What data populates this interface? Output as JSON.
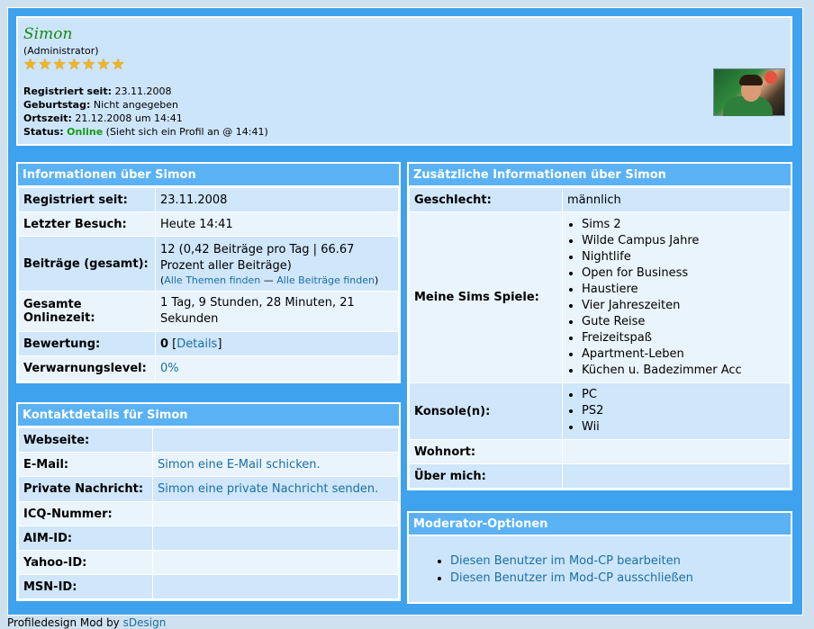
{
  "profile": {
    "username": "Simon",
    "role": "(Administrator)",
    "rank_stars": 7,
    "registered_label": "Registriert seit:",
    "registered_value": "23.11.2008",
    "birthday_label": "Geburtstag:",
    "birthday_value": "Nicht angegeben",
    "localtime_label": "Ortszeit:",
    "localtime_value": "21.12.2008 um 14:41",
    "status_label": "Status:",
    "status_value": "Online",
    "status_note": "(Sieht sich ein Profil an @ 14:41)"
  },
  "info": {
    "title": "Informationen über Simon",
    "rows": {
      "registered": {
        "label": "Registriert seit:",
        "value": "23.11.2008"
      },
      "lastvisit": {
        "label": "Letzter Besuch:",
        "value": "Heute 14:41"
      },
      "posts": {
        "label": "Beiträge (gesamt):",
        "value": "12 (0,42 Beiträge pro Tag | 66.67 Prozent aller Beiträge)",
        "open": "(",
        "link_threads": "Alle Themen finden",
        "sep": " — ",
        "link_posts": "Alle Beiträge finden",
        "close": ")"
      },
      "online": {
        "label": "Gesamte Onlinezeit:",
        "value": "1 Tag, 9 Stunden, 28 Minuten, 21 Sekunden"
      },
      "rating": {
        "label": "Bewertung:",
        "value": "0",
        "open": " [",
        "link": "Details",
        "close": "]"
      },
      "warn": {
        "label": "Verwarnungslevel:",
        "value": "0%"
      }
    }
  },
  "contact": {
    "title": "Kontaktdetails für Simon",
    "rows": {
      "website": {
        "label": "Webseite:",
        "value": ""
      },
      "email": {
        "label": "E-Mail:",
        "value": "Simon eine E-Mail schicken."
      },
      "pm": {
        "label": "Private Nachricht:",
        "value": "Simon eine private Nachricht senden."
      },
      "icq": {
        "label": "ICQ-Nummer:",
        "value": ""
      },
      "aim": {
        "label": "AIM-ID:",
        "value": ""
      },
      "yahoo": {
        "label": "Yahoo-ID:",
        "value": ""
      },
      "msn": {
        "label": "MSN-ID:",
        "value": ""
      }
    }
  },
  "extra": {
    "title": "Zusätzliche Informationen über Simon",
    "gender": {
      "label": "Geschlecht:",
      "value": "männlich"
    },
    "games": {
      "label": "Meine Sims Spiele:",
      "items": [
        "Sims 2",
        "Wilde Campus Jahre",
        "Nightlife",
        "Open for Business",
        "Haustiere",
        "Vier Jahreszeiten",
        "Gute Reise",
        "Freizeitspaß",
        "Apartment-Leben",
        "Küchen u. Badezimmer Acc"
      ]
    },
    "consoles": {
      "label": "Konsole(n):",
      "items": [
        "PC",
        "PS2",
        "Wii"
      ]
    },
    "location": {
      "label": "Wohnort:",
      "value": ""
    },
    "about": {
      "label": "Über mich:",
      "value": ""
    }
  },
  "moderator": {
    "title": "Moderator-Optionen",
    "links": [
      "Diesen Benutzer im Mod-CP bearbeiten",
      "Diesen Benutzer im Mod-CP ausschließen"
    ]
  },
  "footer": {
    "text": "Profiledesign Mod by ",
    "link": "sDesign"
  },
  "colors": {
    "frame": "#3fa2ee",
    "panel": "#cde5fb",
    "header_bar": "#5ab2f4",
    "online": "#169a16",
    "username": "#168a16",
    "link": "#1a6fa3"
  }
}
